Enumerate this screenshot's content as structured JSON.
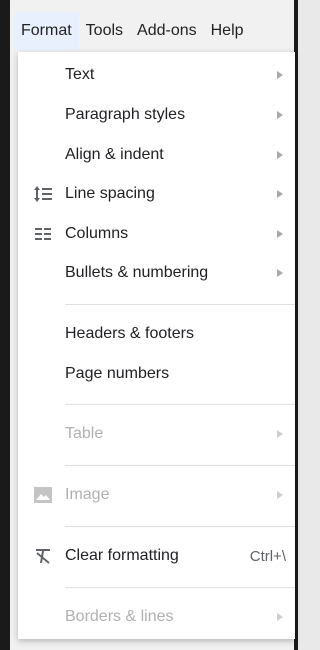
{
  "menubar": {
    "items": [
      {
        "label": "Format",
        "active": true
      },
      {
        "label": "Tools"
      },
      {
        "label": "Add-ons"
      },
      {
        "label": "Help"
      }
    ]
  },
  "format_menu": {
    "items": [
      {
        "label": "Text",
        "submenu": true,
        "enabled": true
      },
      {
        "label": "Paragraph styles",
        "submenu": true,
        "enabled": true
      },
      {
        "label": "Align & indent",
        "submenu": true,
        "enabled": true
      },
      {
        "label": "Line spacing",
        "submenu": true,
        "enabled": true,
        "icon": "line-spacing-icon"
      },
      {
        "label": "Columns",
        "submenu": true,
        "enabled": true,
        "icon": "columns-icon"
      },
      {
        "label": "Bullets & numbering",
        "submenu": true,
        "enabled": true
      },
      {
        "label": "Headers & footers",
        "enabled": true
      },
      {
        "label": "Page numbers",
        "enabled": true
      },
      {
        "label": "Table",
        "submenu": true,
        "enabled": false
      },
      {
        "label": "Image",
        "submenu": true,
        "enabled": false,
        "icon": "image-icon"
      },
      {
        "label": "Clear formatting",
        "shortcut": "Ctrl+\\",
        "enabled": true,
        "icon": "clear-formatting-icon"
      },
      {
        "label": "Borders & lines",
        "submenu": true,
        "enabled": false
      }
    ]
  },
  "colors": {
    "active_menu_bg": "#e8f0fe",
    "disabled_text": "#b0b0b0",
    "text": "#202124"
  }
}
